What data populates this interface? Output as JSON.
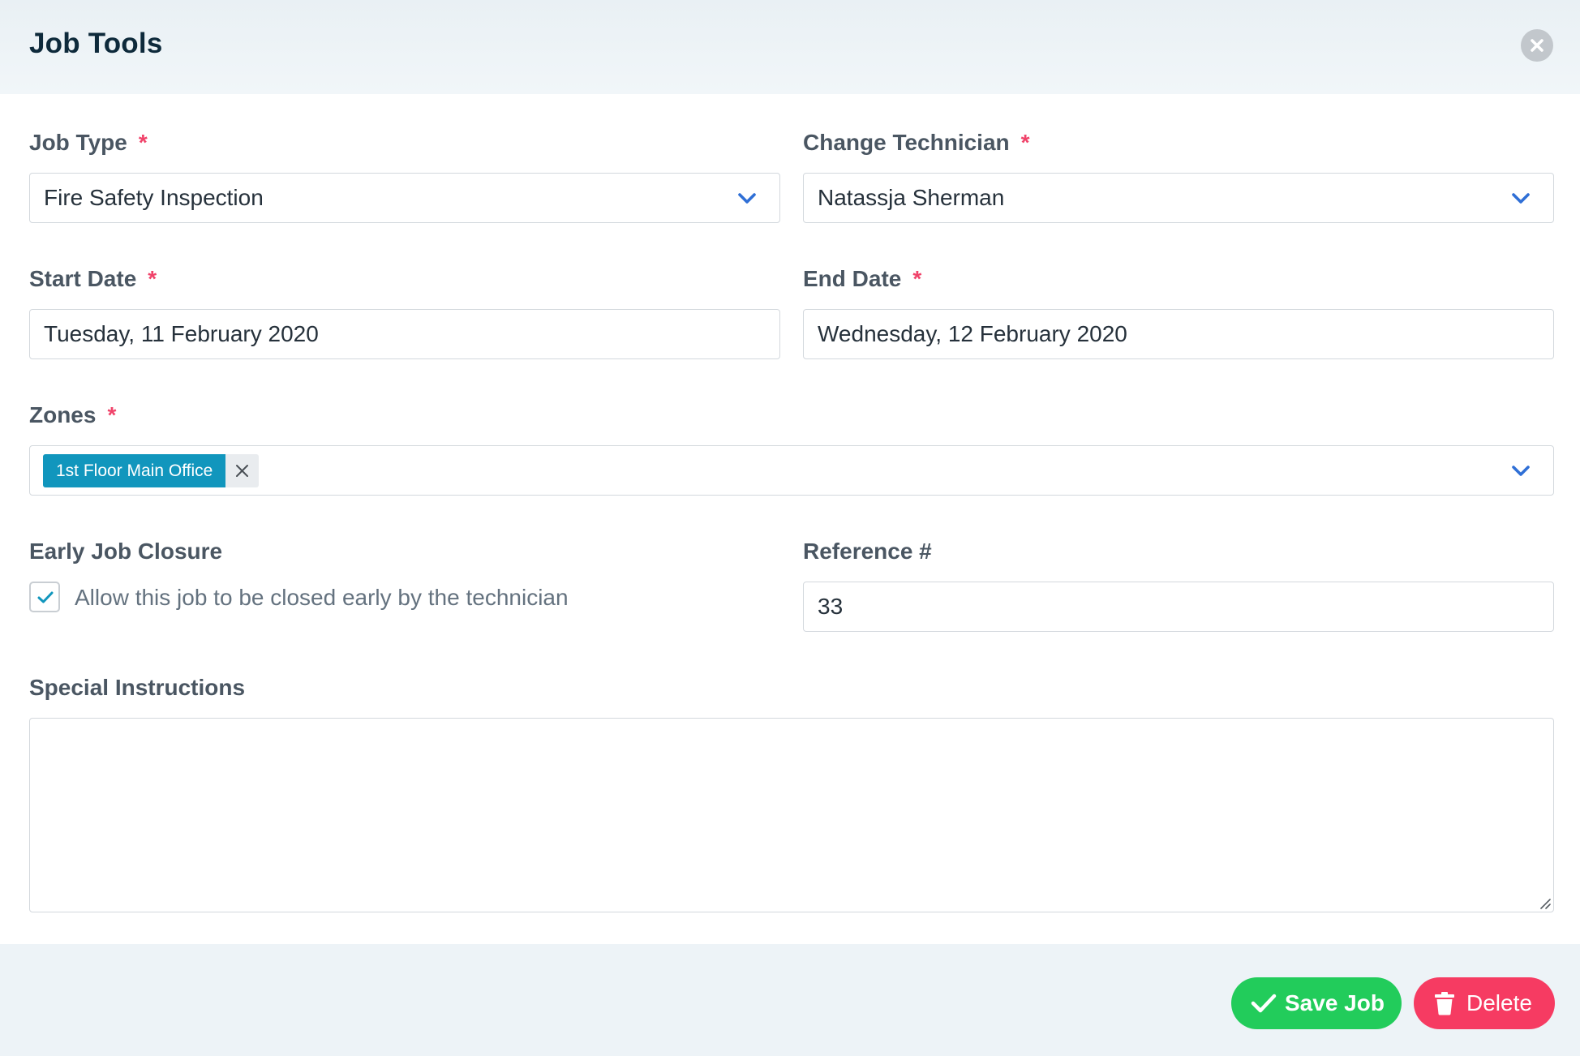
{
  "dialog": {
    "title": "Job Tools",
    "close_icon": "close-icon"
  },
  "form": {
    "required_mark": "*",
    "job_type": {
      "label": "Job Type",
      "value": "Fire Safety Inspection",
      "icon": "chevron-down-icon"
    },
    "technician": {
      "label": "Change Technician",
      "value": "Natassja Sherman",
      "icon": "chevron-down-icon"
    },
    "start_date": {
      "label": "Start Date",
      "value": "Tuesday, 11 February 2020"
    },
    "end_date": {
      "label": "End Date",
      "value": "Wednesday, 12 February 2020"
    },
    "zones": {
      "label": "Zones",
      "tags": [
        "1st Floor Main Office"
      ],
      "icon": "chevron-down-icon"
    },
    "early_closure": {
      "label": "Early Job Closure",
      "checkbox_text": "Allow this job to be closed early by the technician",
      "checked": true
    },
    "reference": {
      "label": "Reference #",
      "value": "33"
    },
    "special_instructions": {
      "label": "Special Instructions",
      "value": ""
    }
  },
  "actions": {
    "save_label": "Save Job",
    "delete_label": "Delete"
  },
  "colors": {
    "accent_blue": "#1196bd",
    "chevron_blue": "#2f6fd6",
    "required_red": "#f0436a",
    "save_green": "#22cc5b",
    "delete_red": "#f63b62"
  }
}
